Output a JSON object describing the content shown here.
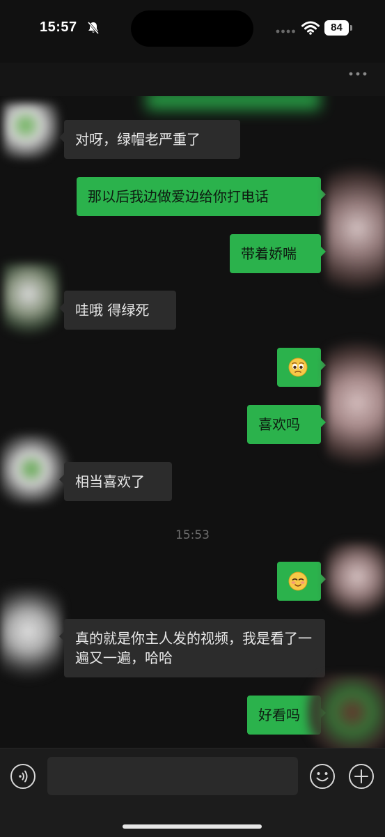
{
  "status_bar": {
    "time": "15:57",
    "battery": "84"
  },
  "messages": [
    {
      "side": "left",
      "text": "对呀，绿帽老严重了"
    },
    {
      "side": "right",
      "text": "那以后我边做爱边给你打电话"
    },
    {
      "side": "right",
      "text": "带着娇喘"
    },
    {
      "side": "left",
      "text": "哇哦 得绿死"
    },
    {
      "side": "right",
      "emoji": "pleading-face"
    },
    {
      "side": "right",
      "text": "喜欢吗"
    },
    {
      "side": "left",
      "text": "相当喜欢了"
    },
    {
      "side": "right",
      "emoji": "blushing-face"
    },
    {
      "side": "left",
      "text": "真的就是你主人发的视频，我是看了一遍又一遍，哈哈"
    },
    {
      "side": "right",
      "text": "好看吗"
    }
  ],
  "timestamp_divider": "15:53",
  "input": {
    "value": "",
    "placeholder": ""
  },
  "icons": {
    "status": [
      "bell-slash-icon",
      "cellular-icon",
      "wifi-icon",
      "battery-icon"
    ],
    "header": [
      "more-icon"
    ],
    "input_bar": [
      "voice-icon",
      "emoji-icon",
      "add-icon"
    ]
  },
  "colors": {
    "background": "#111111",
    "bubble_incoming": "#2c2c2c",
    "bubble_outgoing": "#2bb24c",
    "input_bar": "#1c1c1c",
    "timestamp": "#6d6d6d"
  }
}
